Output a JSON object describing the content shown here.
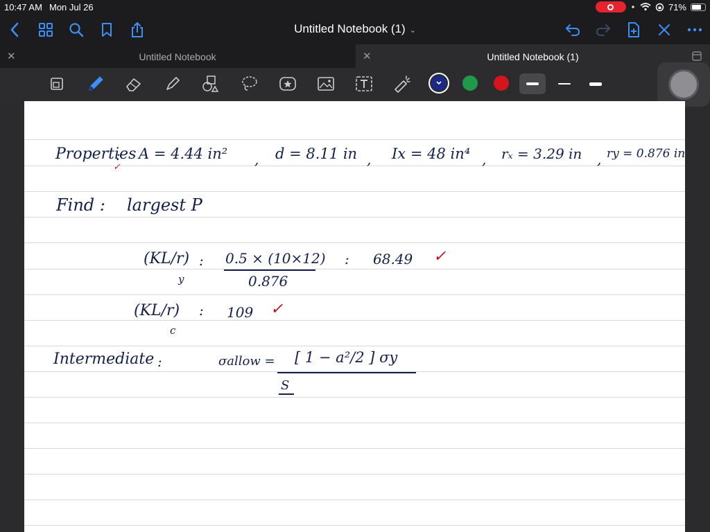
{
  "status": {
    "time": "10:47 AM",
    "date": "Mon Jul 26",
    "battery": "71%",
    "battery_level": 0.71
  },
  "nav": {
    "title": "Untitled Notebook (1)"
  },
  "tabs": [
    {
      "label": "Untitled Notebook",
      "active": false
    },
    {
      "label": "Untitled Notebook (1)",
      "active": true
    }
  ],
  "toolbar": {
    "tools": [
      "zoom-window-icon",
      "pen-icon",
      "eraser-icon",
      "highlighter-icon",
      "shapes-icon",
      "lasso-icon",
      "sticker-icon",
      "image-icon",
      "text-icon",
      "laser-pointer-icon"
    ],
    "colors": [
      "#1b2a86",
      "#1f9a4b",
      "#d5141e"
    ],
    "selected_color": "#1b2a86",
    "selected_width": 0
  },
  "note": {
    "line1": {
      "properties": "Properties",
      "colon": ":",
      "area": "A = 4.44 in²",
      "sep1": ",",
      "depth": "d = 8.11 in",
      "sep2": ",",
      "ix": "Ix = 48 in⁴",
      "sep3": ",",
      "rx": "rₓ = 3.29 in",
      "sep4": ",",
      "ry": "ry = 0.876 in"
    },
    "line2": {
      "find": "Find :",
      "target": "largest P"
    },
    "line3": {
      "lhs": "(KL/r)",
      "sub": "y",
      "eq": ":",
      "numerator": "0.5 × (10×12)",
      "denominator": "0.876",
      "eq2": ":",
      "result": "68.49"
    },
    "line4": {
      "lhs": "(KL/r)",
      "sub": "c",
      "eq": ":",
      "value": "109"
    },
    "line5": {
      "label": "Intermediate",
      "colon": ":",
      "sigma": "σallow =",
      "bracket": "[ 1 − a²/2 ] σy",
      "denominator": "S"
    },
    "checkmark": "✓",
    "red_marks": "#c0111b"
  }
}
